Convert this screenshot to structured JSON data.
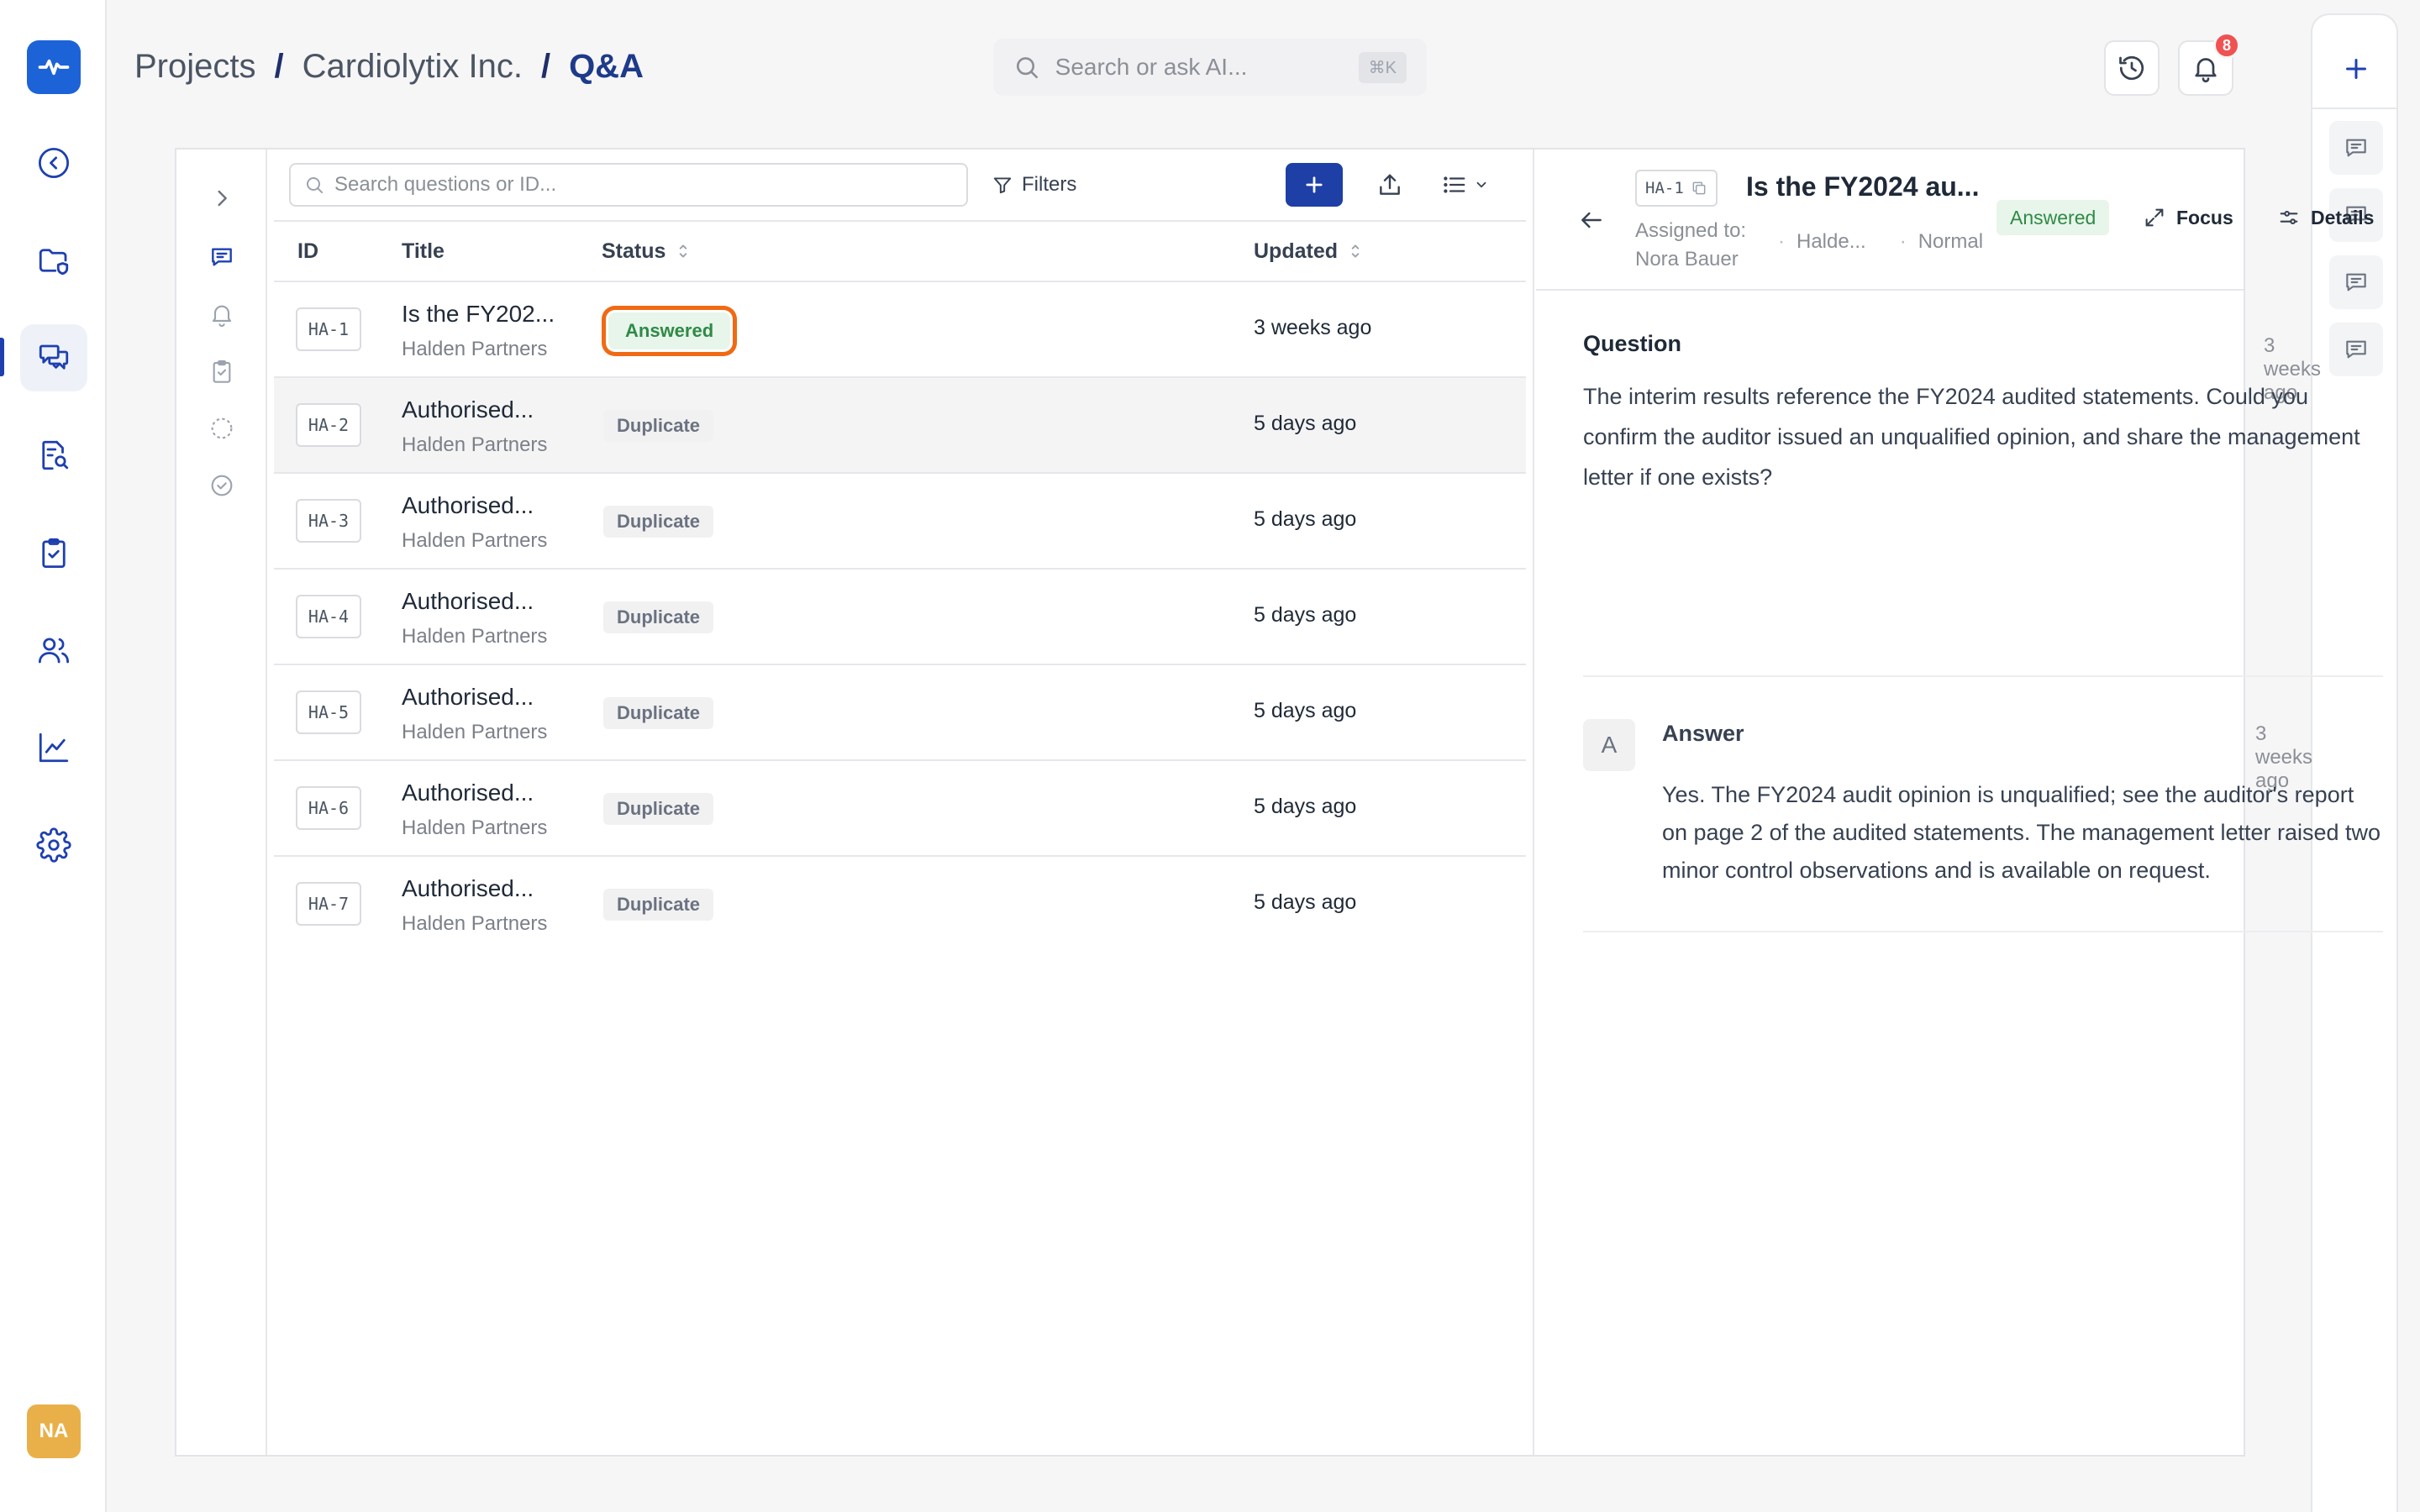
{
  "breadcrumb": {
    "items": [
      "Projects",
      "Cardiolytix Inc."
    ],
    "current": "Q&A",
    "separator": "/"
  },
  "global_search": {
    "placeholder": "Search or ask AI...",
    "shortcut": "⌘K"
  },
  "notifications": {
    "count": "8"
  },
  "user": {
    "initials": "NA"
  },
  "left_rail": {
    "items": [
      "back",
      "documents",
      "qa",
      "review",
      "tasks",
      "team",
      "analytics",
      "settings"
    ],
    "active": "qa",
    "accent": "#1d63d8"
  },
  "sub_rail": {
    "items": [
      "expand",
      "questions",
      "notifications",
      "checklist",
      "pending",
      "done"
    ]
  },
  "list": {
    "search_placeholder": "Search questions or ID...",
    "filters_label": "Filters",
    "columns": {
      "id": "ID",
      "title": "Title",
      "status": "Status",
      "updated": "Updated"
    },
    "rows": [
      {
        "id": "HA-1",
        "title": "Is the FY202...",
        "party": "Halden Partners",
        "status": "Answered",
        "updated": "3 weeks ago",
        "selected": true
      },
      {
        "id": "HA-2",
        "title": "Authorised...",
        "party": "Halden Partners",
        "status": "Duplicate",
        "updated": "5 days ago"
      },
      {
        "id": "HA-3",
        "title": "Authorised...",
        "party": "Halden Partners",
        "status": "Duplicate",
        "updated": "5 days ago"
      },
      {
        "id": "HA-4",
        "title": "Authorised...",
        "party": "Halden Partners",
        "status": "Duplicate",
        "updated": "5 days ago"
      },
      {
        "id": "HA-5",
        "title": "Authorised...",
        "party": "Halden Partners",
        "status": "Duplicate",
        "updated": "5 days ago"
      },
      {
        "id": "HA-6",
        "title": "Authorised...",
        "party": "Halden Partners",
        "status": "Duplicate",
        "updated": "5 days ago"
      },
      {
        "id": "HA-7",
        "title": "Authorised...",
        "party": "Halden Partners",
        "status": "Duplicate",
        "updated": "5 days ago"
      }
    ]
  },
  "detail": {
    "id": "HA-1",
    "title": "Is the FY2024 au...",
    "assigned_label": "Assigned to:",
    "assignee": "Nora Bauer",
    "party": "Halde...",
    "priority": "Normal",
    "status": "Answered",
    "focus_label": "Focus",
    "details_label": "Details",
    "question_label": "Question",
    "question_time": "3 weeks ago",
    "question_text": "The interim results reference the FY2024 audited statements. Could you confirm the auditor issued an unqualified opinion, and share the management letter if one exists?",
    "answer_avatar": "A",
    "answer_label": "Answer",
    "answer_time": "3 weeks ago",
    "answer_text": "Yes. The FY2024 audit opinion is unqualified; see the auditor's report on page 2 of the audited statements. The management letter raised two minor control observations and is available on request."
  },
  "colors": {
    "accent": "#1e3fa6",
    "answered_bg": "#e8f5ea",
    "answered_fg": "#2f8a47",
    "highlight_ring": "#f06a14",
    "badge": "#f05252",
    "avatar": "#e9b04a"
  }
}
